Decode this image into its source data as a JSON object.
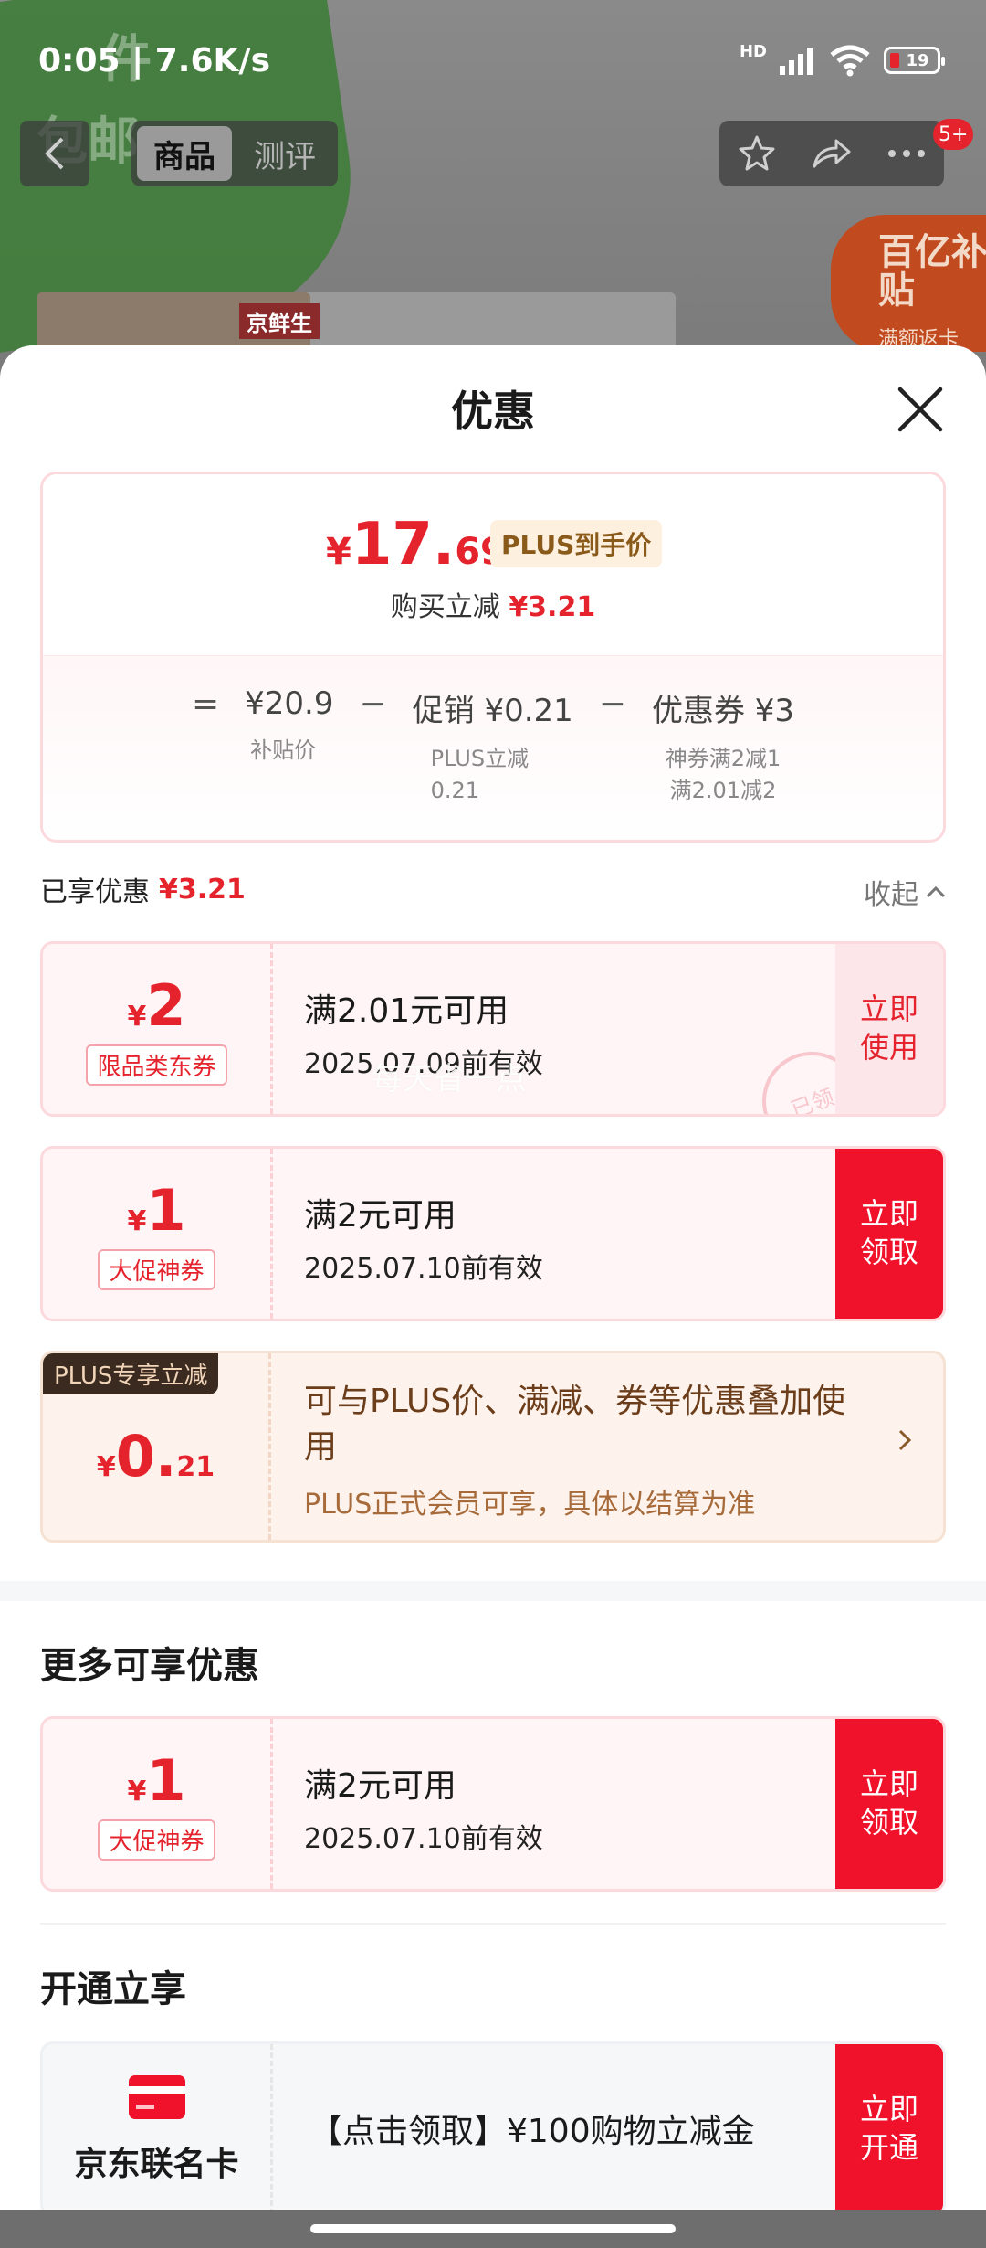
{
  "status_bar": {
    "time": "0:05 | 7.6K/s",
    "network": "HD",
    "battery": "19"
  },
  "background": {
    "promo_text_1": "件",
    "promo_text_2": "包邮",
    "brand": "京鲜生",
    "sticker_title": "百亿补贴",
    "sticker_sub": "满额返卡"
  },
  "nav": {
    "tabs": [
      {
        "label": "商品",
        "active": true
      },
      {
        "label": "测评",
        "active": false
      }
    ],
    "message_badge": "5+"
  },
  "sheet": {
    "title": "优惠"
  },
  "summary": {
    "final_price_symbol": "¥",
    "final_price_int": "17.",
    "final_price_dec": "69",
    "plus_tag": "PLUS到手价",
    "reduce_label": "购买立减",
    "reduce_value": "¥3.21",
    "formula": {
      "eq": "=",
      "items": [
        {
          "value": "¥20.9",
          "desc": "补贴价"
        },
        {
          "value": "促销 ¥0.21",
          "desc": "PLUS立减\n0.21"
        },
        {
          "value": "优惠券 ¥3",
          "desc": "神券满2减1\n满2.01减2"
        }
      ],
      "minus": "−"
    }
  },
  "enjoyed": {
    "label": "已享优惠",
    "value": "¥3.21",
    "collapse": "收起"
  },
  "coupons": [
    {
      "symbol": "¥",
      "amount": "2",
      "tag": "限品类东券",
      "condition": "满2.01元可用",
      "validity": "2025.07.09前有效",
      "button": "立即\n使用",
      "button_style": "pink",
      "stamp": "已领",
      "watermark": "每天省一点"
    },
    {
      "symbol": "¥",
      "amount": "1",
      "tag": "大促神券",
      "condition": "满2元可用",
      "validity": "2025.07.10前有效",
      "button": "立即\n领取",
      "button_style": "red"
    }
  ],
  "plus_card": {
    "ribbon": "PLUS专享立减",
    "symbol": "¥",
    "int": "0.",
    "dec": "21",
    "title": "可与PLUS价、满减、券等优惠叠加使用",
    "subtitle": "PLUS正式会员可享，具体以结算为准"
  },
  "more_section": {
    "title": "更多可享优惠",
    "coupon": {
      "symbol": "¥",
      "amount": "1",
      "tag": "大促神券",
      "condition": "满2元可用",
      "validity": "2025.07.10前有效",
      "button": "立即\n领取"
    }
  },
  "open_section": {
    "title": "开通立享",
    "card_name": "京东联名卡",
    "offer": "【点击领取】¥100购物立减金",
    "button": "立即\n开通"
  },
  "colors": {
    "accent_red": "#e5232d",
    "button_red": "#f0112b",
    "plus_brown": "#6b3d1a"
  }
}
